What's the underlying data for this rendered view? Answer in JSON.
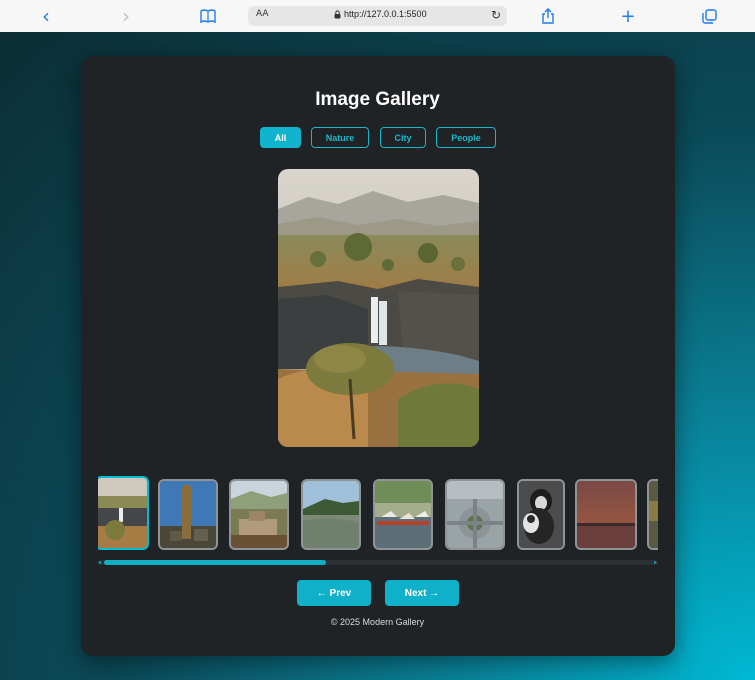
{
  "browser": {
    "url": "http://127.0.0.1:5500",
    "aa_label": "AA",
    "back_glyph": "‹",
    "forward_glyph": "›",
    "reload_glyph": "↻",
    "new_tab_glyph": "+",
    "icons": [
      "chevron-left-icon",
      "chevron-right-icon",
      "book-icon",
      "lock-icon",
      "reload-icon",
      "share-icon",
      "plus-icon",
      "tabs-icon"
    ]
  },
  "gallery": {
    "title": "Image Gallery",
    "filters": [
      {
        "label": "All",
        "active": true
      },
      {
        "label": "Nature",
        "active": false
      },
      {
        "label": "City",
        "active": false
      },
      {
        "label": "People",
        "active": false
      }
    ],
    "prev_label": "← Prev",
    "next_label": "Next →",
    "footer": "© 2025 Modern Gallery",
    "accent_color": "#10b4cf",
    "selected_thumbnail": 1,
    "thumbnail_count_visible": 9
  }
}
